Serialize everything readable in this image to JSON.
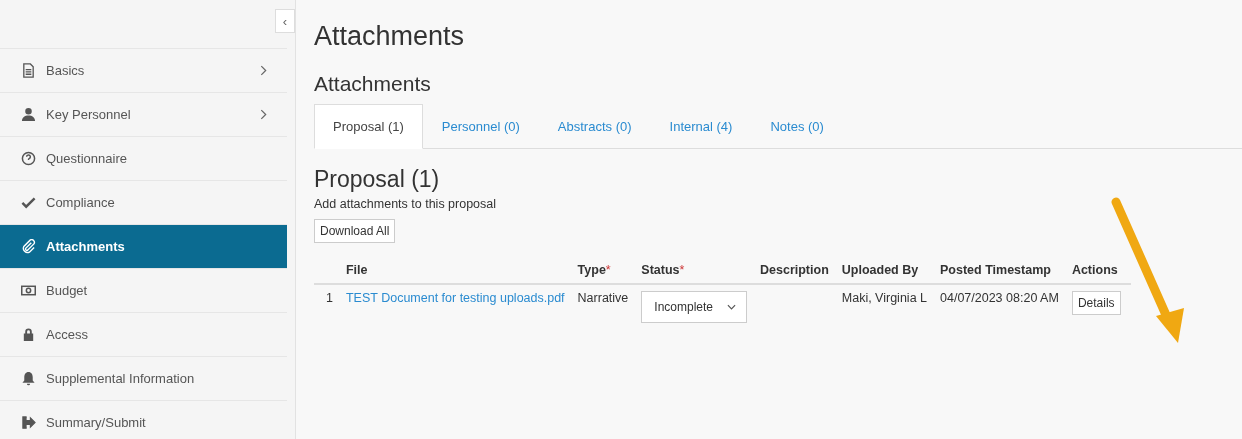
{
  "sidebar": {
    "collapse_toggle": "‹",
    "items": [
      {
        "label": "Basics",
        "has_submenu": true,
        "selected": false
      },
      {
        "label": "Key Personnel",
        "has_submenu": true,
        "selected": false
      },
      {
        "label": "Questionnaire",
        "has_submenu": false,
        "selected": false
      },
      {
        "label": "Compliance",
        "has_submenu": false,
        "selected": false
      },
      {
        "label": "Attachments",
        "has_submenu": false,
        "selected": true
      },
      {
        "label": "Budget",
        "has_submenu": false,
        "selected": false
      },
      {
        "label": "Access",
        "has_submenu": false,
        "selected": false
      },
      {
        "label": "Supplemental Information",
        "has_submenu": false,
        "selected": false
      },
      {
        "label": "Summary/Submit",
        "has_submenu": false,
        "selected": false
      }
    ]
  },
  "page_title": "Attachments",
  "section_title": "Attachments",
  "tabs": [
    {
      "label": "Proposal (1)",
      "selected": true
    },
    {
      "label": "Personnel (0)",
      "selected": false
    },
    {
      "label": "Abstracts (0)",
      "selected": false
    },
    {
      "label": "Internal (4)",
      "selected": false
    },
    {
      "label": "Notes (0)",
      "selected": false
    }
  ],
  "panel": {
    "title": "Proposal (1)",
    "description": "Add attachments to this proposal",
    "download_button": "Download All"
  },
  "table": {
    "columns": [
      {
        "label": "File",
        "required": false
      },
      {
        "label": "Type",
        "required": true
      },
      {
        "label": "Status",
        "required": true
      },
      {
        "label": "Description",
        "required": false
      },
      {
        "label": "Uploaded By",
        "required": false
      },
      {
        "label": "Posted Timestamp",
        "required": false
      },
      {
        "label": "Actions",
        "required": false
      }
    ],
    "required_mark": "*",
    "rows": [
      {
        "number": "1",
        "file": "TEST Document for testing uploads.pdf",
        "type": "Narrative",
        "status": "Incomplete",
        "description": "",
        "uploaded_by": "Maki, Virginia L",
        "posted": "04/07/2023 08:20 AM",
        "action": "Details"
      }
    ]
  }
}
